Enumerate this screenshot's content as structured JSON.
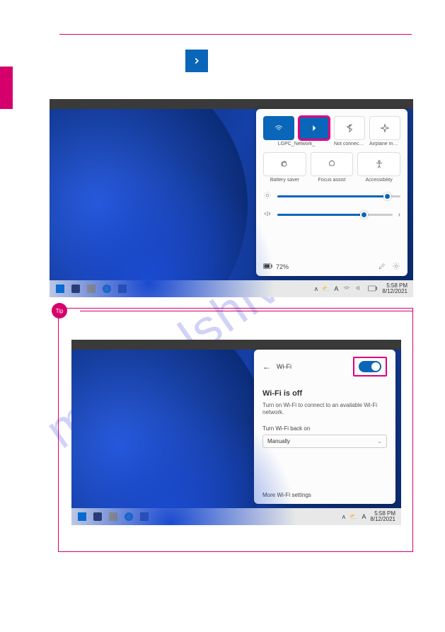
{
  "tip_label": "Tip",
  "shot1": {
    "tiles": {
      "wifi_label": "LGPC_Network_",
      "bt_label": "Not connected",
      "airplane_label": "Airplane mode",
      "battery_saver_label": "Battery saver",
      "focus_label": "Focus assist",
      "access_label": "Accessibility"
    },
    "battery_text": "72%",
    "clock_time": "5:58 PM",
    "clock_date": "8/12/2021",
    "tray_letter": "A"
  },
  "shot2": {
    "wifi_header": "Wi-Fi",
    "wifi_off_title": "Wi-Fi is off",
    "wifi_off_body": "Turn on Wi-Fi to connect to an available Wi-Fi network.",
    "turn_back_label": "Turn Wi-Fi back on",
    "dropdown_value": "Manually",
    "more_link": "More Wi-Fi settings",
    "clock_time": "5:58 PM",
    "clock_date": "8/12/2021",
    "tray_letter": "A"
  },
  "watermark": "manualshive.com"
}
